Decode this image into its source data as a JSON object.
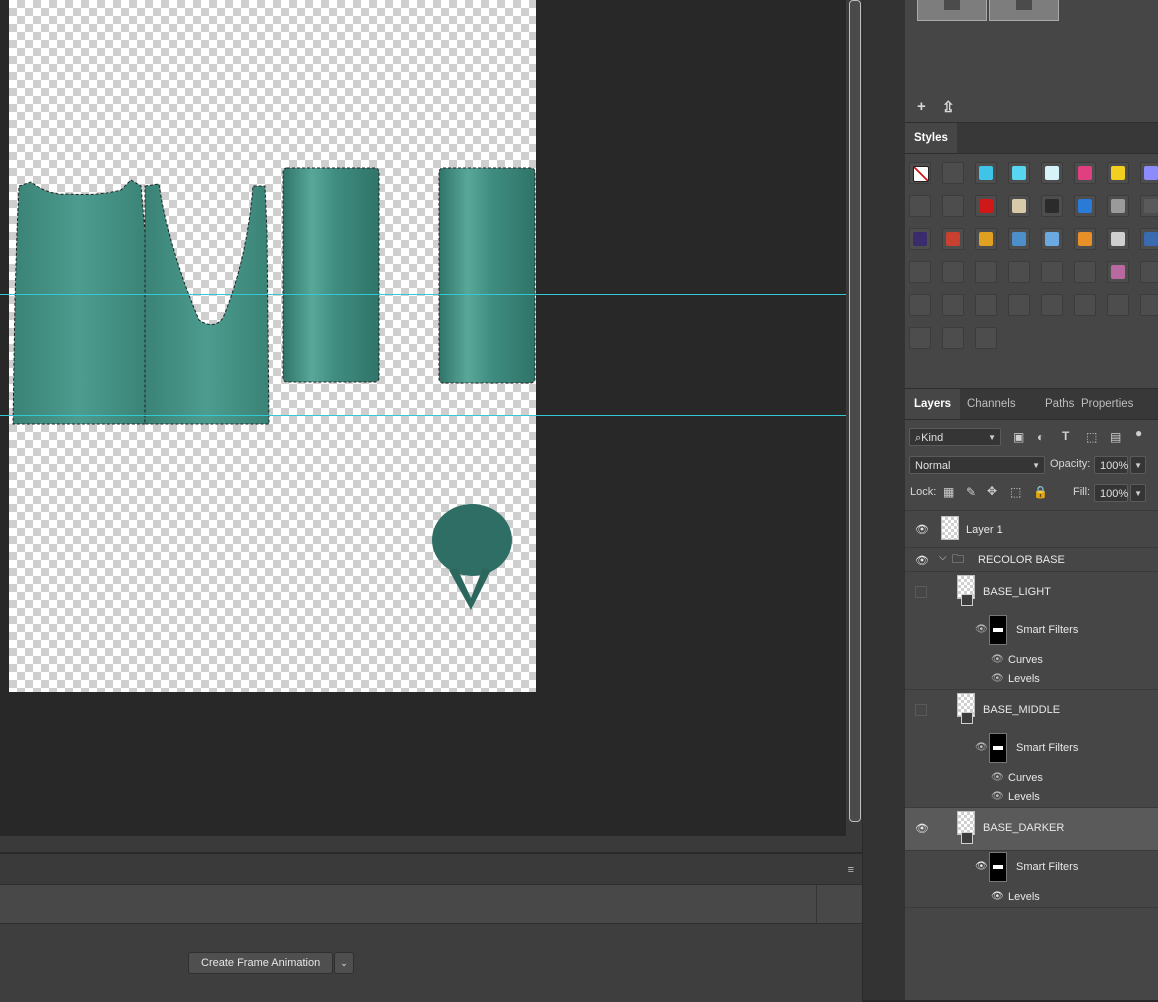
{
  "timeline": {
    "create_button_label": "Create Frame Animation",
    "dropdown_arrow": "⌄",
    "menu_icon": "≡"
  },
  "styles_panel": {
    "tab_label": "Styles",
    "grid": [
      [
        "none",
        "#4d4d4d",
        "#3fc4e8",
        "#58d6f0",
        "#d8f2fa",
        "#e04080",
        "#f2d020",
        "#8c8cff"
      ],
      [
        "#4d4d4d",
        "#4d4d4d",
        "#d01818",
        "#d8c9a8",
        "#2b2b2b",
        "#2a7ad8",
        "#9a9a9a",
        "#5a5a5a"
      ],
      [
        "#3a2c6c",
        "#c84030",
        "#e0a020",
        "#4d8fc8",
        "#6aaae0",
        "#e89028",
        "#cfcfcf",
        "#3a6ab0"
      ],
      [
        "#4d4d4d",
        "#4d4d4d",
        "#4d4d4d",
        "#4d4d4d",
        "#4d4d4d",
        "#4d4d4d",
        "#b86aa0",
        "#4d4d4d"
      ],
      [
        "#4d4d4d",
        "#4d4d4d",
        "#4d4d4d",
        "#4d4d4d",
        "#4d4d4d",
        "#4d4d4d",
        "#4d4d4d",
        "#4d4d4d"
      ],
      [
        "#4d4d4d",
        "#4d4d4d",
        "#4d4d4d"
      ]
    ]
  },
  "layers_panel": {
    "tabs": [
      "Layers",
      "Channels",
      "Paths",
      "Properties"
    ],
    "filter_kind": "Kind",
    "blend_mode": "Normal",
    "opacity_label": "Opacity:",
    "opacity_value": "100%",
    "lock_label": "Lock:",
    "fill_label": "Fill:",
    "fill_value": "100%",
    "layers": {
      "layer1": "Layer 1",
      "group": "RECOLOR BASE",
      "base_light": "BASE_LIGHT",
      "base_middle": "BASE_MIDDLE",
      "base_darker": "BASE_DARKER",
      "smart_filters": "Smart Filters",
      "curves": "Curves",
      "levels": "Levels"
    }
  },
  "colors": {
    "garment_teal": "#3f8c80",
    "garment_dark": "#2a5e55",
    "guide_cyan": "#33c8d4",
    "canvas_bg": "#282828",
    "panel_bg": "#464646"
  },
  "icons": {
    "eye": "eye-icon",
    "folder": "folder-icon",
    "new_layer": "new-layer-icon",
    "upload": "upload-icon"
  }
}
